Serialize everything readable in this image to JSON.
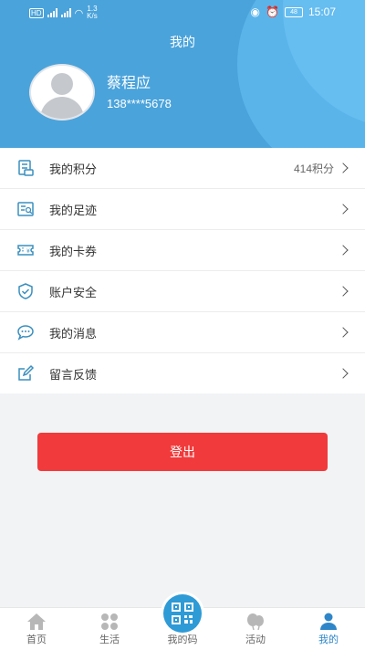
{
  "status_bar": {
    "network_speed": "1.3",
    "network_unit": "K/s",
    "time": "15:07",
    "battery": "48"
  },
  "header": {
    "title": "我的",
    "user_name": "蔡程应",
    "phone": "138****5678"
  },
  "menu": [
    {
      "label": "我的积分",
      "value": "414积分",
      "icon": "points-card-icon"
    },
    {
      "label": "我的足迹",
      "value": "",
      "icon": "footprint-icon"
    },
    {
      "label": "我的卡券",
      "value": "",
      "icon": "coupon-icon"
    },
    {
      "label": "账户安全",
      "value": "",
      "icon": "shield-check-icon"
    },
    {
      "label": "我的消息",
      "value": "",
      "icon": "message-bubble-icon"
    },
    {
      "label": "留言反馈",
      "value": "",
      "icon": "edit-feedback-icon"
    }
  ],
  "logout_label": "登出",
  "tabs": [
    {
      "label": "首页",
      "icon": "home-icon"
    },
    {
      "label": "生活",
      "icon": "grid-icon"
    },
    {
      "label": "我的码",
      "icon": "qr-code-icon"
    },
    {
      "label": "活动",
      "icon": "activity-icon"
    },
    {
      "label": "我的",
      "icon": "person-icon",
      "active": true
    }
  ],
  "colors": {
    "header_bg": "#4aa3db",
    "accent": "#2e86c9",
    "logout_bg": "#f13a3b",
    "icon": "#3a8fbf"
  }
}
